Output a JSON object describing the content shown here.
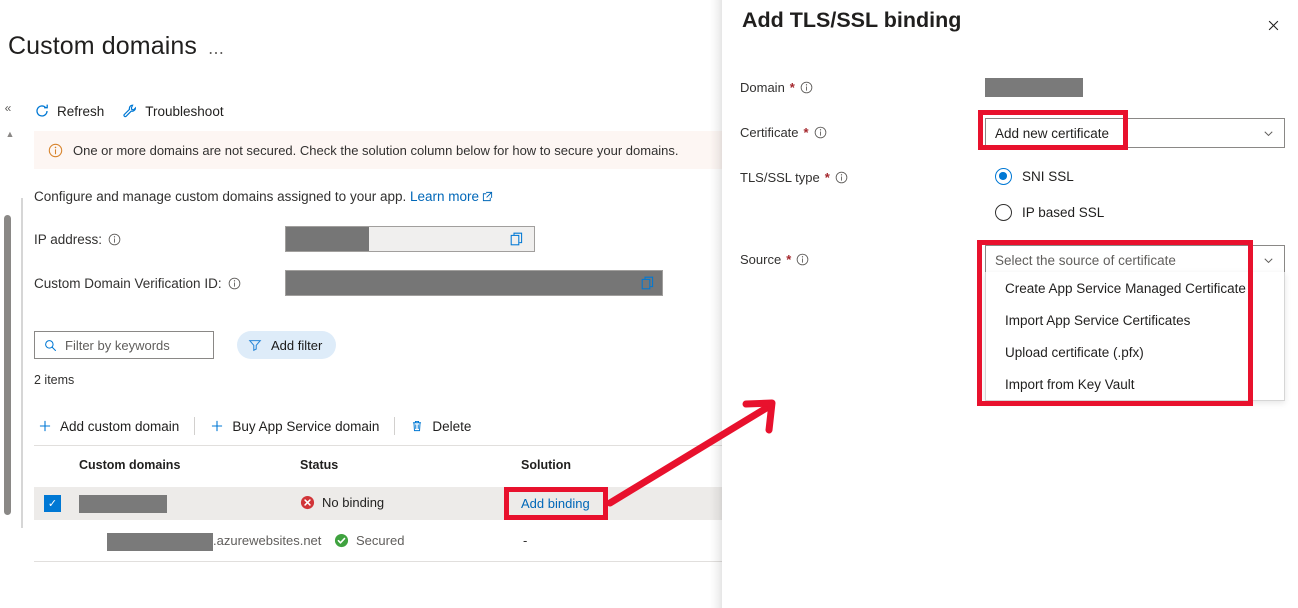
{
  "blade": {
    "page_title": "Custom domains",
    "title_more": "⋯",
    "commands": [
      {
        "label": "Refresh",
        "icon": "refresh-icon"
      },
      {
        "label": "Troubleshoot",
        "icon": "wrench-icon"
      }
    ],
    "info_bar": {
      "icon": "info-circle-icon",
      "text": "One or more domains are not secured. Check the solution column below for how to secure your domains."
    },
    "description": "Configure and manage custom domains assigned to your app.",
    "learn_more": "Learn more",
    "fields": [
      {
        "label": "IP address:",
        "icon": "info-circle-icon",
        "value": "",
        "copy_icon": "copy-icon"
      },
      {
        "label": "Custom Domain Verification ID:",
        "icon": "info-circle-icon",
        "value": "",
        "copy_icon": "copy-icon"
      }
    ],
    "filter_placeholder": "Filter by keywords",
    "add_filter_label": "Add filter",
    "add_filter_icon": "funnel-icon",
    "items_count": "2 items",
    "table_toolbar": [
      {
        "label": "Add custom domain",
        "icon": "plus-icon"
      },
      {
        "label": "Buy App Service domain",
        "icon": "plus-icon"
      },
      {
        "label": "Delete",
        "icon": "trash-icon"
      }
    ],
    "table": {
      "columns": [
        "Custom domains",
        "Status",
        "Solution"
      ],
      "rows": [
        {
          "selected": true,
          "domain_redacted": true,
          "domain_suffix": "",
          "status": "No binding",
          "status_icon": "error-icon",
          "status_color": "#d13438",
          "solution": "Add binding",
          "solution_is_link": true
        },
        {
          "selected": false,
          "domain_redacted": true,
          "domain_suffix": ".azurewebsites.net",
          "status": "Secured",
          "status_icon": "success-icon",
          "status_color": "#3fa23f",
          "solution": "-",
          "solution_is_link": false
        }
      ]
    }
  },
  "panel": {
    "title": "Add TLS/SSL binding",
    "close_icon": "close-icon",
    "domain": {
      "label": "Domain",
      "required": "*",
      "info_icon": "info-circle-icon",
      "value": ""
    },
    "certificate": {
      "label": "Certificate",
      "required": "*",
      "info_icon": "info-circle-icon",
      "selected": "Add new certificate",
      "caret_icon": "chevron-down-icon"
    },
    "tls_type": {
      "label": "TLS/SSL type",
      "required": "*",
      "info_icon": "info-circle-icon",
      "options": [
        {
          "label": "SNI SSL",
          "selected": true
        },
        {
          "label": "IP based SSL",
          "selected": false
        }
      ]
    },
    "source": {
      "label": "Source",
      "required": "*",
      "info_icon": "info-circle-icon",
      "placeholder": "Select the source of certificate",
      "caret_icon": "chevron-down-icon",
      "options": [
        "Create App Service Managed Certificate",
        "Import App Service Certificates",
        "Upload certificate (.pfx)",
        "Import from Key Vault"
      ]
    }
  },
  "annotations": {
    "highlight_color": "#e8112d",
    "arrow": "points from Add binding link to the Source dropdown list"
  }
}
